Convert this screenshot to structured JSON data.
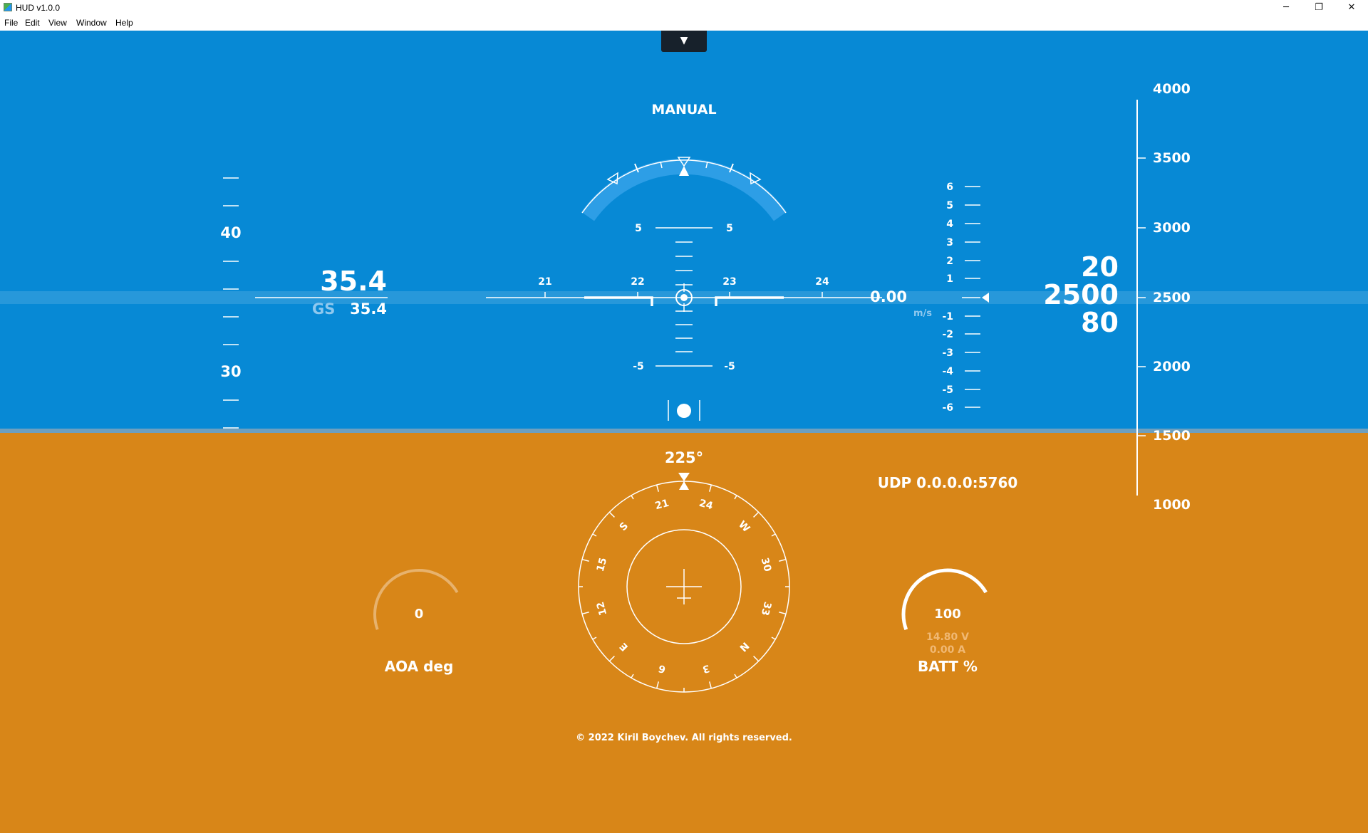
{
  "window": {
    "title": "HUD v1.0.0",
    "minimize": "─",
    "maximize": "❐",
    "close": "✕"
  },
  "menu": {
    "items": [
      "File",
      "Edit",
      "View",
      "Window",
      "Help"
    ]
  },
  "toggle": {
    "symbol": "▼",
    "icon": "caret-down-icon"
  },
  "colors": {
    "sky": "#0789d5",
    "ground": "#d88618",
    "white": "#ffffff",
    "faint": "#8fc8ee"
  },
  "mode": "MANUAL",
  "speed_tape": {
    "labels": [
      "40",
      "30"
    ],
    "airspeed": "35.4",
    "gs_label": "GS",
    "ground_speed": "35.4"
  },
  "pitch_ladder": {
    "top_left": "5",
    "top_right": "5",
    "bottom_left": "-5",
    "bottom_right": "-5"
  },
  "heading_scale": {
    "labels": [
      "21",
      "22",
      "23",
      "24"
    ]
  },
  "vertical_speed": {
    "value": "0.00",
    "unit": "m/s",
    "scale": [
      "6",
      "5",
      "4",
      "3",
      "2",
      "1",
      "-1",
      "-2",
      "-3",
      "-4",
      "-5",
      "-6"
    ]
  },
  "altitude": {
    "upper": "20",
    "current": "2500",
    "lower": "80"
  },
  "altitude_tape": {
    "labels": [
      "4000",
      "3500",
      "3000",
      "2500",
      "2000",
      "1500",
      "1000"
    ]
  },
  "heading": {
    "value": "225°",
    "compass_labels": [
      "21",
      "24",
      "W",
      "30",
      "33",
      "N",
      "3",
      "6",
      "E",
      "12",
      "15",
      "S"
    ]
  },
  "connection": "UDP 0.0.0.0:5760",
  "aoa": {
    "value": "0",
    "label": "AOA deg",
    "level": 0
  },
  "battery": {
    "value": "100",
    "voltage": "14.80 V",
    "current": "0.00 A",
    "label": "BATT %",
    "level": 1.0
  },
  "footer": "© 2022 Kiril Boychev. All rights reserved."
}
